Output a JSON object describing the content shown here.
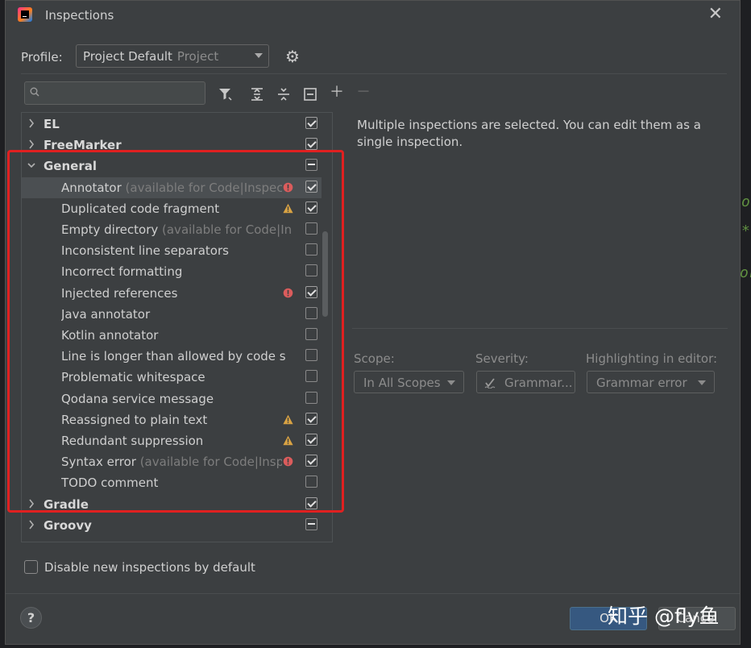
{
  "window": {
    "title": "Inspections",
    "close_glyph": "✕"
  },
  "profile": {
    "label": "Profile:",
    "value": "Project Default",
    "scope": "Project"
  },
  "search": {
    "placeholder": ""
  },
  "tree": {
    "groups": [
      {
        "label": "EL",
        "expanded": false,
        "state": "checked"
      },
      {
        "label": "FreeMarker",
        "expanded": false,
        "state": "checked"
      },
      {
        "label": "General",
        "expanded": true,
        "state": "mixed"
      }
    ],
    "general_items": [
      {
        "name": "Annotator",
        "hint": "(available for Code|Inspect",
        "severity": "error",
        "checked": true
      },
      {
        "name": "Duplicated code fragment",
        "hint": "",
        "severity": "warning",
        "checked": true
      },
      {
        "name": "Empty directory",
        "hint": "(available for Code|In",
        "severity": "",
        "checked": false
      },
      {
        "name": "Inconsistent line separators",
        "hint": "",
        "severity": "",
        "checked": false
      },
      {
        "name": "Incorrect formatting",
        "hint": "",
        "severity": "",
        "checked": false
      },
      {
        "name": "Injected references",
        "hint": "",
        "severity": "error",
        "checked": true
      },
      {
        "name": "Java annotator",
        "hint": "",
        "severity": "",
        "checked": false
      },
      {
        "name": "Kotlin annotator",
        "hint": "",
        "severity": "",
        "checked": false
      },
      {
        "name": "Line is longer than allowed by code s",
        "hint": "",
        "severity": "",
        "checked": false
      },
      {
        "name": "Problematic whitespace",
        "hint": "",
        "severity": "",
        "checked": false
      },
      {
        "name": "Qodana service message",
        "hint": "",
        "severity": "",
        "checked": false
      },
      {
        "name": "Reassigned to plain text",
        "hint": "",
        "severity": "warning",
        "checked": true
      },
      {
        "name": "Redundant suppression",
        "hint": "",
        "severity": "warning",
        "checked": true
      },
      {
        "name": "Syntax error",
        "hint": "(available for Code|Inspe",
        "severity": "error",
        "checked": true
      },
      {
        "name": "TODO comment",
        "hint": "",
        "severity": "",
        "checked": false
      }
    ],
    "after_groups": [
      {
        "label": "Gradle",
        "expanded": false,
        "state": "checked"
      },
      {
        "label": "Groovy",
        "expanded": false,
        "state": "mixed"
      }
    ]
  },
  "details": {
    "message": "Multiple inspections are selected. You can edit them as a single inspection."
  },
  "options": {
    "scope_label": "Scope:",
    "scope_value": "In All Scopes",
    "severity_label": "Severity:",
    "severity_value": "Grammar...",
    "highlight_label": "Highlighting in editor:",
    "highlight_value": "Grammar error"
  },
  "footer": {
    "disable_label": "Disable new inspections by default",
    "help": "?",
    "ok": "OK",
    "cancel": "Cancel"
  },
  "watermark": "知乎 @fly鱼",
  "colors": {
    "error": "#db5c5c",
    "warning": "#d9a343",
    "accent": "#365880",
    "annotation": "#e02020"
  }
}
